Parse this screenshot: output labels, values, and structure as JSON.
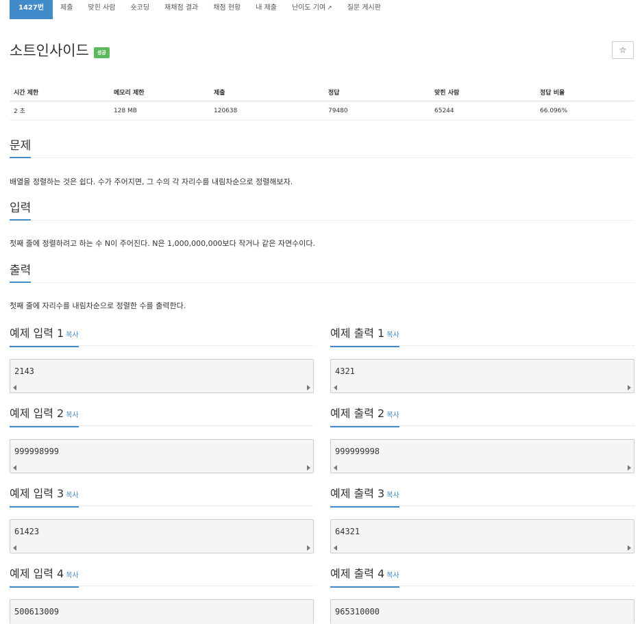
{
  "tabs": [
    {
      "label": "1427번",
      "active": true
    },
    {
      "label": "제출"
    },
    {
      "label": "맞힌 사람"
    },
    {
      "label": "숏코딩"
    },
    {
      "label": "재채점 결과"
    },
    {
      "label": "채점 현황"
    },
    {
      "label": "내 제출"
    },
    {
      "label": "난이도 기여"
    },
    {
      "label": "질문 게시판"
    }
  ],
  "problem": {
    "title": "소트인사이드",
    "badge": "성공",
    "star": "☆"
  },
  "info": {
    "headers": [
      "시간 제한",
      "메모리 제한",
      "제출",
      "정답",
      "맞힌 사람",
      "정답 비율"
    ],
    "values": [
      "2 초",
      "128 MB",
      "120638",
      "79480",
      "65244",
      "66.096%"
    ]
  },
  "sections": {
    "problem_head": "문제",
    "problem_text": "배열을 정렬하는 것은 쉽다. 수가 주어지면, 그 수의 각 자리수를 내림차순으로 정렬해보자.",
    "input_head": "입력",
    "input_text": "첫째 줄에 정렬하려고 하는 수 N이 주어진다. N은 1,000,000,000보다 작거나 같은 자연수이다.",
    "output_head": "출력",
    "output_text": "첫째 줄에 자리수를 내림차순으로 정렬한 수를 출력한다."
  },
  "copy_label": "복사",
  "examples": [
    {
      "in_label": "예제 입력 1",
      "out_label": "예제 출력 1",
      "in": "2143",
      "out": "4321"
    },
    {
      "in_label": "예제 입력 2",
      "out_label": "예제 출력 2",
      "in": "999998999",
      "out": "999999998"
    },
    {
      "in_label": "예제 입력 3",
      "out_label": "예제 출력 3",
      "in": "61423",
      "out": "64321"
    },
    {
      "in_label": "예제 입력 4",
      "out_label": "예제 출력 4",
      "in": "500613009",
      "out": "965310000"
    }
  ]
}
